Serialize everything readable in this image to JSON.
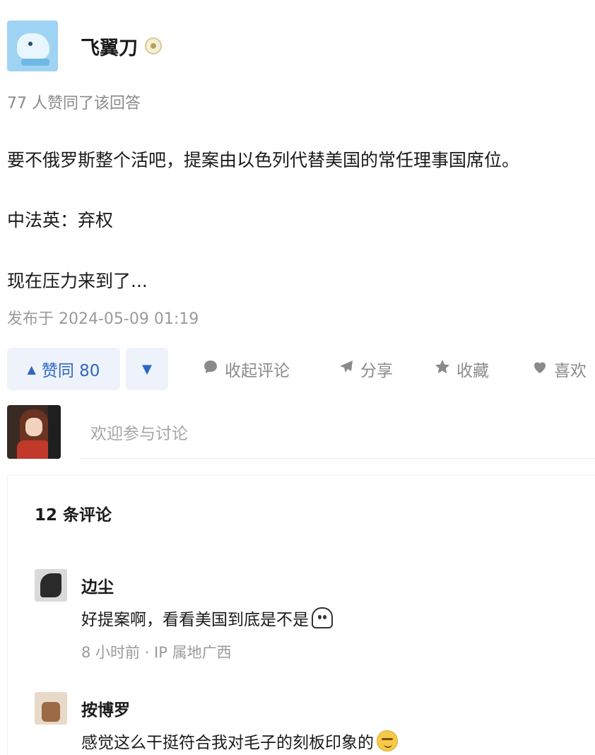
{
  "author": {
    "name": "飞翼刀",
    "avatar_icon": "avatar-icon",
    "badge_icon": "badge-icon"
  },
  "answer": {
    "likes_line": "77 人赞同了该回答",
    "paragraphs": [
      "要不俄罗斯整个活吧，提案由以色列代替美国的常任理事国席位。",
      "中法英：弃权",
      "现在压力来到了..."
    ],
    "publish_time": "发布于 2024-05-09 01:19"
  },
  "actions": {
    "vote_up_label": "赞同 80",
    "vote_up_icon": "▲",
    "vote_down_icon": "▼",
    "comment_label": "收起评论",
    "share_label": "分享",
    "collect_label": "收藏",
    "like_label": "喜欢",
    "accent_color": "#2f66c4"
  },
  "composer": {
    "placeholder": "欢迎参与讨论"
  },
  "comments": {
    "title": "12 条评论",
    "items": [
      {
        "name": "边尘",
        "text": "好提案啊，看看美国到底是不是",
        "emoji": "ghost-emoji",
        "meta": "8 小时前 · IP 属地广西"
      },
      {
        "name": "按博罗",
        "text": "感觉这么干挺符合我对毛子的刻板印象的",
        "emoji": "smirk-emoji"
      }
    ]
  }
}
